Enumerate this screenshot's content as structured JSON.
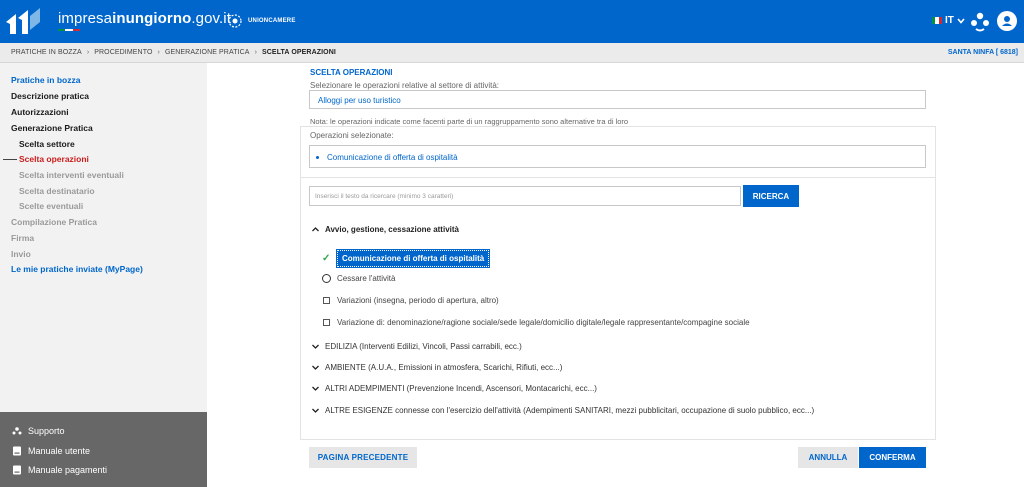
{
  "header": {
    "site_title_plain": "impresa",
    "site_title_bold": "inungiorno",
    "site_title_suffix": ".gov.it",
    "partner": "UNIONCAMERE",
    "language": "IT",
    "brand_color": "#0066cc"
  },
  "breadcrumb": {
    "items": [
      "PRATICHE IN BOZZA",
      "PROCEDIMENTO",
      "GENERAZIONE PRATICA"
    ],
    "current": "SCELTA OPERAZIONI",
    "company": "SANTA NINFA [ 6818]"
  },
  "sidebar": {
    "items": [
      {
        "label": "Pratiche in bozza"
      },
      {
        "label": "Descrizione pratica"
      },
      {
        "label": "Autorizzazioni"
      },
      {
        "label": "Generazione Pratica"
      },
      {
        "label": "Scelta settore"
      },
      {
        "label": "Scelta operazioni"
      },
      {
        "label": "Scelta interventi eventuali"
      },
      {
        "label": "Scelta destinatario"
      },
      {
        "label": "Scelte eventuali"
      },
      {
        "label": "Compilazione Pratica"
      },
      {
        "label": "Firma"
      },
      {
        "label": "Invio"
      },
      {
        "label": "Le mie pratiche inviate (MyPage)"
      }
    ],
    "footer": [
      {
        "label": "Supporto",
        "icon": "support-icon"
      },
      {
        "label": "Manuale utente",
        "icon": "book-icon"
      },
      {
        "label": "Manuale pagamenti",
        "icon": "book-icon"
      }
    ]
  },
  "main": {
    "title": "SCELTA OPERAZIONI",
    "subtitle": "Selezionare le operazioni relative al settore di attività:",
    "sector": "Alloggi per uso turistico",
    "note": "Nota: le operazioni indicate come facenti parte di un raggruppamento sono alternative tra di loro",
    "selected_label": "Operazioni selezionate:",
    "selected_items": [
      "Comunicazione di offerta di ospitalità"
    ],
    "search_placeholder": "Inserisci il testo da ricercare (minimo 3 caratteri)",
    "search_button": "RICERCA",
    "open_group": "Avvio, gestione, cessazione attività",
    "operations": [
      {
        "label": "Comunicazione di offerta di ospitalità",
        "state": "selected"
      },
      {
        "label": "Cessare l'attività",
        "state": "radio"
      },
      {
        "label": "Variazioni (insegna, periodo di apertura, altro)",
        "state": "checkbox"
      },
      {
        "label": "Variazione di: denominazione/ragione sociale/sede legale/domicilio digitale/legale rappresentante/compagine sociale",
        "state": "checkbox"
      }
    ],
    "groups": [
      "EDILIZIA (Interventi Edilizi, Vincoli, Passi carrabili, ecc.)",
      "AMBIENTE (A.U.A., Emissioni in atmosfera, Scarichi, Rifiuti, ecc...)",
      "ALTRI ADEMPIMENTI (Prevenzione Incendi, Ascensori, Montacarichi, ecc...)",
      "ALTRE ESIGENZE connesse con l'esercizio dell'attività (Adempimenti SANITARI, mezzi pubblicitari, occupazione di suolo pubblico, ecc...)"
    ],
    "buttons": {
      "previous": "PAGINA PRECEDENTE",
      "cancel": "ANNULLA",
      "confirm": "CONFERMA"
    }
  }
}
